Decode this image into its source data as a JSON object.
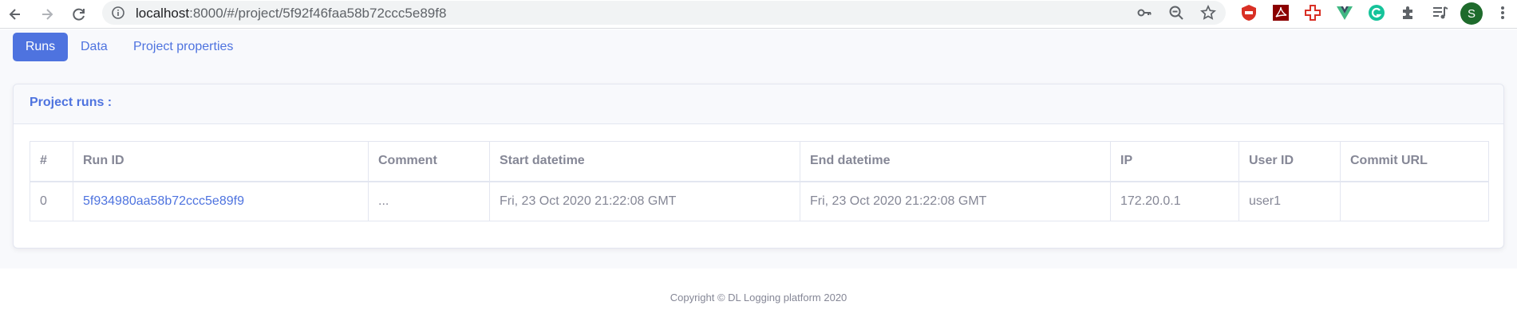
{
  "browser": {
    "url_host": "localhost",
    "url_path": ":8000/#/project/5f92f46faa58b72ccc5e89f8",
    "profile_initial": "S",
    "icons": [
      "back-icon",
      "forward-icon",
      "reload-icon",
      "info-icon",
      "key-icon",
      "zoom-out-icon",
      "star-icon",
      "extension-icon",
      "puzzle-icon",
      "media-icon",
      "menu-icon"
    ]
  },
  "nav": {
    "tabs": [
      {
        "label": "Runs",
        "active": true
      },
      {
        "label": "Data",
        "active": false
      },
      {
        "label": "Project properties",
        "active": false
      }
    ]
  },
  "runs_card": {
    "title": "Project runs :",
    "columns": [
      "#",
      "Run ID",
      "Comment",
      "Start datetime",
      "End datetime",
      "IP",
      "User ID",
      "Commit URL"
    ],
    "rows": [
      {
        "index": "0",
        "run_id": "5f934980aa58b72ccc5e89f9",
        "comment": "...",
        "start": "Fri, 23 Oct 2020 21:22:08 GMT",
        "end": "Fri, 23 Oct 2020 21:22:08 GMT",
        "ip": "172.20.0.1",
        "user_id": "user1",
        "commit_url": ""
      }
    ]
  },
  "footer": {
    "copyright": "Copyright © DL Logging platform 2020"
  },
  "colors": {
    "primary": "#4e73df",
    "text_muted": "#858796",
    "page_bg": "#f8f9fc"
  }
}
